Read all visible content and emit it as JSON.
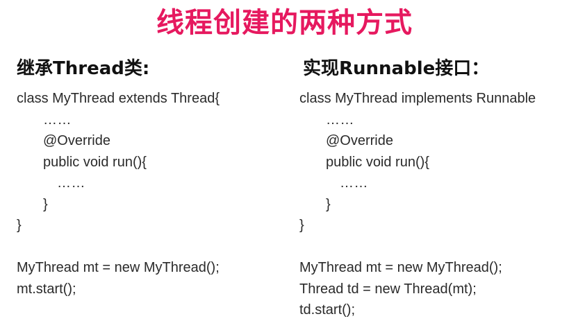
{
  "title": "线程创建的两种方式",
  "left": {
    "heading": "继承Thread类:",
    "code_lines": [
      "class MyThread extends Thread{",
      "……",
      "@Override",
      "public void run(){",
      "……",
      "}",
      "}",
      "",
      "MyThread mt = new MyThread();",
      "mt.start();"
    ]
  },
  "right": {
    "heading": "实现Runnable接口：",
    "code_lines": [
      "class MyThread implements Runnable",
      "……",
      "@Override",
      "public void run(){",
      "……",
      "}",
      "}",
      "",
      "MyThread mt = new MyThread();",
      "Thread td = new Thread(mt);",
      "td.start();"
    ]
  },
  "colors": {
    "title": "#e6195f",
    "heading": "#111111",
    "code": "#2a2a2a"
  }
}
